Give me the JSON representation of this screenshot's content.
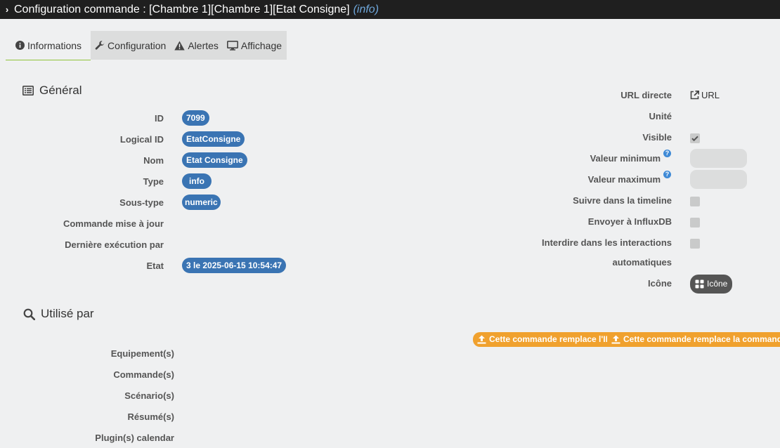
{
  "title": {
    "text": "Configuration commande : [Chambre 1][Chambre 1][Etat Consigne]",
    "type": "(info)"
  },
  "tabs": [
    {
      "label": "Informations",
      "icon": "info-circle-icon"
    },
    {
      "label": "Configuration",
      "icon": "wrench-icon"
    },
    {
      "label": "Alertes",
      "icon": "warning-icon"
    },
    {
      "label": "Affichage",
      "icon": "monitor-icon"
    }
  ],
  "general": {
    "title": "Général",
    "fields": {
      "id": {
        "label": "ID",
        "value": "7099"
      },
      "logical_id": {
        "label": "Logical ID",
        "value": "EtatConsigne"
      },
      "nom": {
        "label": "Nom",
        "value": "Etat Consigne"
      },
      "type": {
        "label": "Type",
        "value": "info"
      },
      "sous_type": {
        "label": "Sous-type",
        "value": "numeric"
      },
      "commande_maj": {
        "label": "Commande mise à jour"
      },
      "derniere_exec": {
        "label": "Dernière exécution par"
      },
      "etat": {
        "label": "Etat",
        "value": "3 le 2025-06-15 10:54:47"
      }
    }
  },
  "right": {
    "url_directe": {
      "label": "URL directe",
      "link": "URL"
    },
    "unite": {
      "label": "Unité"
    },
    "visible": {
      "label": "Visible",
      "checked": true
    },
    "valeur_min": {
      "label": "Valeur minimum",
      "help": "?"
    },
    "valeur_max": {
      "label": "Valeur maximum",
      "help": "?"
    },
    "timeline": {
      "label": "Suivre dans la timeline",
      "checked": false
    },
    "influx": {
      "label": "Envoyer à InfluxDB",
      "checked": false
    },
    "interdire": {
      "label_line1": "Interdire dans les interactions",
      "label_line2": "automatiques",
      "checked": false
    },
    "icone": {
      "label": "Icône",
      "button": "Icône"
    }
  },
  "utilise": {
    "title": "Utilisé par",
    "replace_id_button": "Cette commande remplace l'ID",
    "replace_cmd_button": "Cette commande remplace la commande",
    "rows": [
      "Equipement(s)",
      "Commande(s)",
      "Scénario(s)",
      "Résumé(s)",
      "Plugin(s) calendar"
    ]
  },
  "colors": {
    "pill": "#3a74b3",
    "orange": "#f0a12e",
    "tab_active": "#8fc33a",
    "titlebar": "#1f1f1f"
  }
}
